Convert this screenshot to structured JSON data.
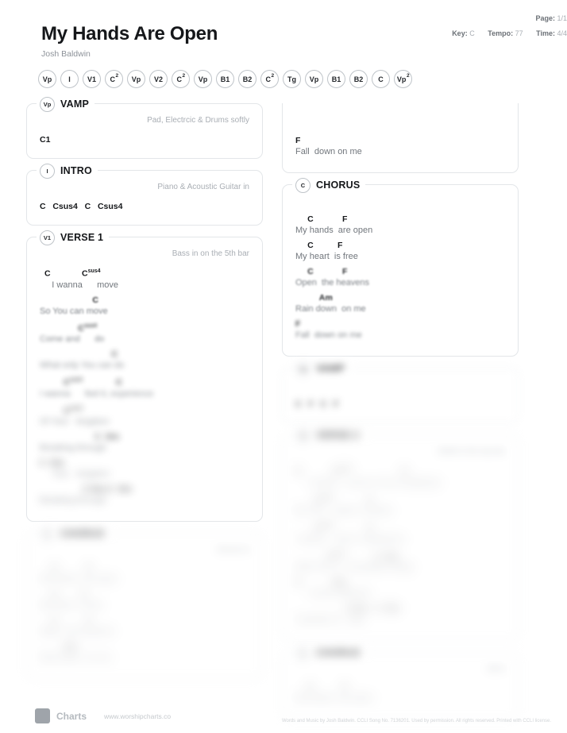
{
  "header": {
    "title": "My Hands Are Open",
    "artist": "Josh Baldwin",
    "page_label": "Page:",
    "page_value": "1/1",
    "key_label": "Key:",
    "key_value": "C",
    "tempo_label": "Tempo:",
    "tempo_value": "77",
    "time_label": "Time:",
    "time_value": "4/4"
  },
  "pills": [
    {
      "base": "Vp",
      "sup": ""
    },
    {
      "base": "I",
      "sup": ""
    },
    {
      "base": "V1",
      "sup": ""
    },
    {
      "base": "C",
      "sup": "2"
    },
    {
      "base": "Vp",
      "sup": ""
    },
    {
      "base": "V2",
      "sup": ""
    },
    {
      "base": "C",
      "sup": "2"
    },
    {
      "base": "Vp",
      "sup": ""
    },
    {
      "base": "B1",
      "sup": ""
    },
    {
      "base": "B2",
      "sup": ""
    },
    {
      "base": "C",
      "sup": "2"
    },
    {
      "base": "Tg",
      "sup": ""
    },
    {
      "base": "Vp",
      "sup": ""
    },
    {
      "base": "B1",
      "sup": ""
    },
    {
      "base": "B2",
      "sup": ""
    },
    {
      "base": "C",
      "sup": ""
    },
    {
      "base": "Vp",
      "sup": "2"
    }
  ],
  "left_column": [
    {
      "id": "vamp",
      "badge": "Vp",
      "badge_sup": "",
      "title": "VAMP",
      "note": "Pad, Electrcic & Drums softly",
      "blur": 0,
      "rows": [
        {
          "type": "chord_only",
          "chord": "C",
          "chord_sup": "1"
        }
      ]
    },
    {
      "id": "intro",
      "badge": "I",
      "badge_sup": "",
      "title": "INTRO",
      "note": "Piano & Acoustic Guitar in",
      "blur": 0,
      "rows": [
        {
          "type": "chord_only",
          "text": "C   Csus4   C   Csus4"
        }
      ]
    },
    {
      "id": "verse-1",
      "badge": "V1",
      "badge_sup": "",
      "title": "VERSE 1",
      "note": "Bass in on the 5th bar",
      "blur": 0,
      "rows": [
        {
          "type": "pair",
          "chords": "  C             Csus4",
          "lyrics": "     I wanna      move",
          "blur": 0
        },
        {
          "type": "pair",
          "chords": "                      C",
          "lyrics": "So You can move",
          "blur": 1
        },
        {
          "type": "pair",
          "chords": "                Csus4",
          "lyrics": "Come and      do",
          "blur": 2
        },
        {
          "type": "pair",
          "chords": "                              C",
          "lyrics": "What only You can do",
          "blur": 3
        },
        {
          "type": "pair",
          "chords": "          Csus4              C",
          "lyrics": "I wanna      feel it, experience",
          "blur": 3
        },
        {
          "type": "pair",
          "chords": "          Csus4",
          "lyrics": "Of Your   kingdom",
          "blur": 4
        },
        {
          "type": "pair",
          "chords": "                       C  Dm",
          "lyrics": "Breaking through",
          "blur": 4
        },
        {
          "type": "pair",
          "chords": "C  Dm",
          "lyrics": "     Your   kingdom",
          "blur": 5
        },
        {
          "type": "pair",
          "chords": "                  C Dm C  Dm",
          "lyrics": "Breaking through",
          "blur": 5
        }
      ]
    },
    {
      "id": "chorus-left",
      "badge": "C",
      "badge_sup": "",
      "title": "CHORUS",
      "note": "Drums in",
      "blur": 5,
      "rows": [
        {
          "type": "pair",
          "chords": "     C            F",
          "lyrics": "My hands  are open",
          "blur": 5
        },
        {
          "type": "pair",
          "chords": "     C          F",
          "lyrics": "My heart  is free",
          "blur": 5
        },
        {
          "type": "pair",
          "chords": "     C            F",
          "lyrics": "Open  the heavens",
          "blur": 5
        },
        {
          "type": "pair",
          "chords": "          Am",
          "lyrics": "Rain down  on me",
          "blur": 5
        }
      ]
    }
  ],
  "right_column": [
    {
      "id": "continuation",
      "badge": "",
      "badge_sup": "",
      "title": "",
      "note": "",
      "clipped": true,
      "blur": 0,
      "rows": [
        {
          "type": "pair",
          "chords": "F",
          "lyrics": "Fall  down on me",
          "blur": 0
        }
      ]
    },
    {
      "id": "chorus",
      "badge": "C",
      "badge_sup": "",
      "title": "CHORUS",
      "note": "",
      "blur": 0,
      "rows": [
        {
          "type": "pair",
          "chords": "     C            F",
          "lyrics": "My hands  are open",
          "blur": 0
        },
        {
          "type": "pair",
          "chords": "     C          F",
          "lyrics": "My heart  is free",
          "blur": 0
        },
        {
          "type": "pair",
          "chords": "     C            F",
          "lyrics": "Open  the heavens",
          "blur": 1
        },
        {
          "type": "pair",
          "chords": "          Am",
          "lyrics": "Rain down  on me",
          "blur": 1
        },
        {
          "type": "pair",
          "chords": "F",
          "lyrics": "Fall  down on me",
          "blur": 2
        }
      ]
    },
    {
      "id": "vamp-2",
      "badge": "Vp",
      "badge_sup": "",
      "title": "VAMP",
      "note": "",
      "blur": 4,
      "rows": [
        {
          "type": "chord_only",
          "text": "C   F   C   F"
        }
      ]
    },
    {
      "id": "verse-2",
      "badge": "V2",
      "badge_sup": "",
      "title": "VERSE 2",
      "note": "Build in the top bar",
      "blur": 5,
      "rows": [
        {
          "type": "pair",
          "chords": "C             Csus4                     C",
          "lyrics": "     I wanna   come to You in boldness",
          "blur": 5
        },
        {
          "type": "pair",
          "chords": "        Csus4              C",
          "lyrics": "By Your   power I receive",
          "blur": 5
        },
        {
          "type": "pair",
          "chords": "        Csus4              C",
          "lyrics": "I wanna    feel it, experience",
          "blur": 5
        },
        {
          "type": "pair",
          "chords": "             Csus4            C  Dm",
          "lyrics": "With You I'll   do greater things",
          "blur": 5
        },
        {
          "type": "pair",
          "chords": "C             Dm",
          "lyrics": "     I never believed",
          "blur": 5
        },
        {
          "type": "pair",
          "chords": "                     C Dm   C  Dm",
          "lyrics": "A greater th   ings",
          "blur": 5
        }
      ]
    },
    {
      "id": "chorus-bottom",
      "badge": "C",
      "badge_sup": "",
      "title": "CHORUS",
      "note": "All in",
      "blur": 5,
      "rows": [
        {
          "type": "pair",
          "chords": "     C            F",
          "lyrics": "My hands  are open",
          "blur": 5
        }
      ]
    }
  ],
  "footer": {
    "wordmark": "Charts",
    "url": "www.worshipcharts.co",
    "copyright": "Words and Music by Josh Baldwin. CCLI Song No. 7136201. Used by permission. All rights reserved. Printed with CCLI license."
  }
}
